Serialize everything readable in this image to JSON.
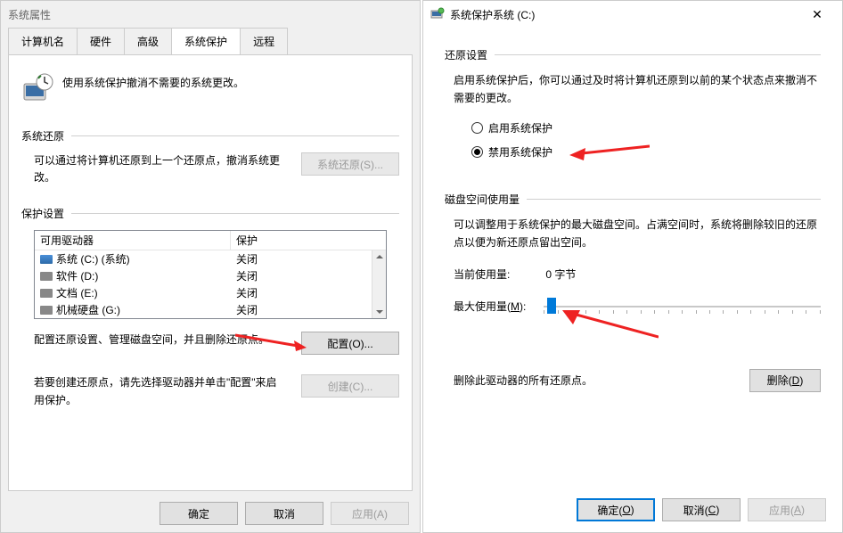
{
  "left": {
    "title": "系统属性",
    "tabs": [
      "计算机名",
      "硬件",
      "高级",
      "系统保护",
      "远程"
    ],
    "activeTab": 3,
    "intro": "使用系统保护撤消不需要的系统更改。",
    "sections": {
      "restore": {
        "title": "系统还原",
        "text": "可以通过将计算机还原到上一个还原点，撤消系统更改。",
        "button": "系统还原(S)..."
      },
      "protect": {
        "title": "保护设置",
        "headers": {
          "drives": "可用驱动器",
          "protection": "保护"
        },
        "drives": [
          {
            "name": "系统 (C:) (系统)",
            "status": "关闭",
            "sys": true
          },
          {
            "name": "软件 (D:)",
            "status": "关闭",
            "sys": false
          },
          {
            "name": "文档 (E:)",
            "status": "关闭",
            "sys": false
          },
          {
            "name": "机械硬盘 (G:)",
            "status": "关闭",
            "sys": false
          }
        ],
        "configText": "配置还原设置、管理磁盘空间，并且删除还原点。",
        "configBtn": "配置(O)...",
        "createText": "若要创建还原点，请先选择驱动器并单击\"配置\"来启用保护。",
        "createBtn": "创建(C)..."
      }
    },
    "buttons": {
      "ok": "确定",
      "cancel": "取消",
      "apply": "应用(A)"
    }
  },
  "right": {
    "title": "系统保护系统 (C:)",
    "close": "✕",
    "restoreSettings": {
      "title": "还原设置",
      "intro": "启用系统保护后，你可以通过及时将计算机还原到以前的某个状态点来撤消不需要的更改。",
      "radioEnable": "启用系统保护",
      "radioDisable": "禁用系统保护"
    },
    "diskUsage": {
      "title": "磁盘空间使用量",
      "intro": "可以调整用于系统保护的最大磁盘空间。占满空间时，系统将删除较旧的还原点以便为新还原点留出空间。",
      "currentLabel": "当前使用量:",
      "currentValue": "0 字节",
      "maxLabel": "最大使用量(M):",
      "deleteText": "删除此驱动器的所有还原点。",
      "deleteBtn": "删除(D)"
    },
    "buttons": {
      "ok": "确定(O)",
      "cancel": "取消(C)",
      "apply": "应用(A)"
    }
  }
}
